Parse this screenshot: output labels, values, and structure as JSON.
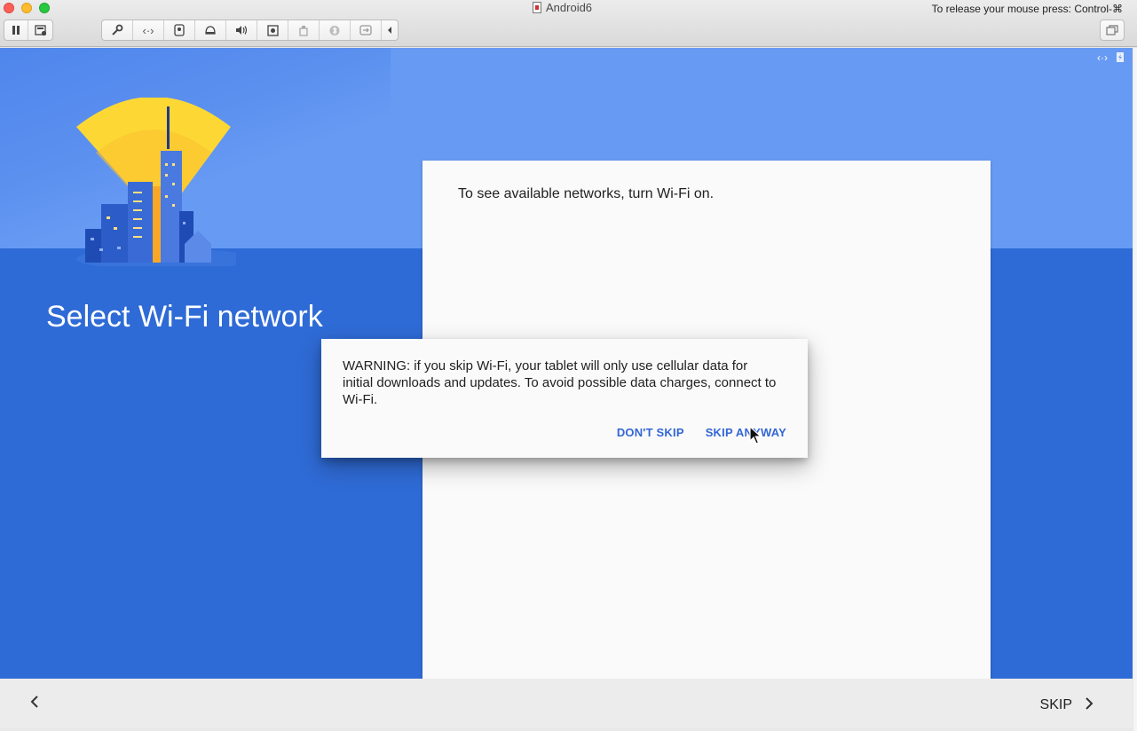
{
  "window": {
    "title": "Android6",
    "release_hint": "To release your mouse press: Control-⌘"
  },
  "toolbar": {
    "left_icons": [
      "pause-icon",
      "snapshot-icon"
    ],
    "device_icons": [
      "wrench-icon",
      "network-icon",
      "hard-disk-icon",
      "camera-icon",
      "sound-icon",
      "video-icon",
      "usb-icon",
      "bluetooth-icon",
      "sharing-icon",
      "collapse-icon"
    ],
    "right_icons": [
      "window-mode-icon"
    ]
  },
  "screen": {
    "title": "Select Wi-Fi network",
    "card_message": "To see available networks, turn Wi-Fi on.",
    "status_icons": [
      "code-icon",
      "battery-icon"
    ]
  },
  "dialog": {
    "message": "WARNING: if you skip Wi-Fi, your tablet will only use cellular data for initial downloads and updates. To avoid possible data charges, connect to Wi-Fi.",
    "dont_skip": "DON'T SKIP",
    "skip_anyway": "SKIP ANYWAY"
  },
  "nav": {
    "skip": "SKIP"
  },
  "colors": {
    "sky": "#679af3",
    "ground": "#2f6bd6",
    "accent": "#3367d6",
    "sun": "#fdd835"
  }
}
